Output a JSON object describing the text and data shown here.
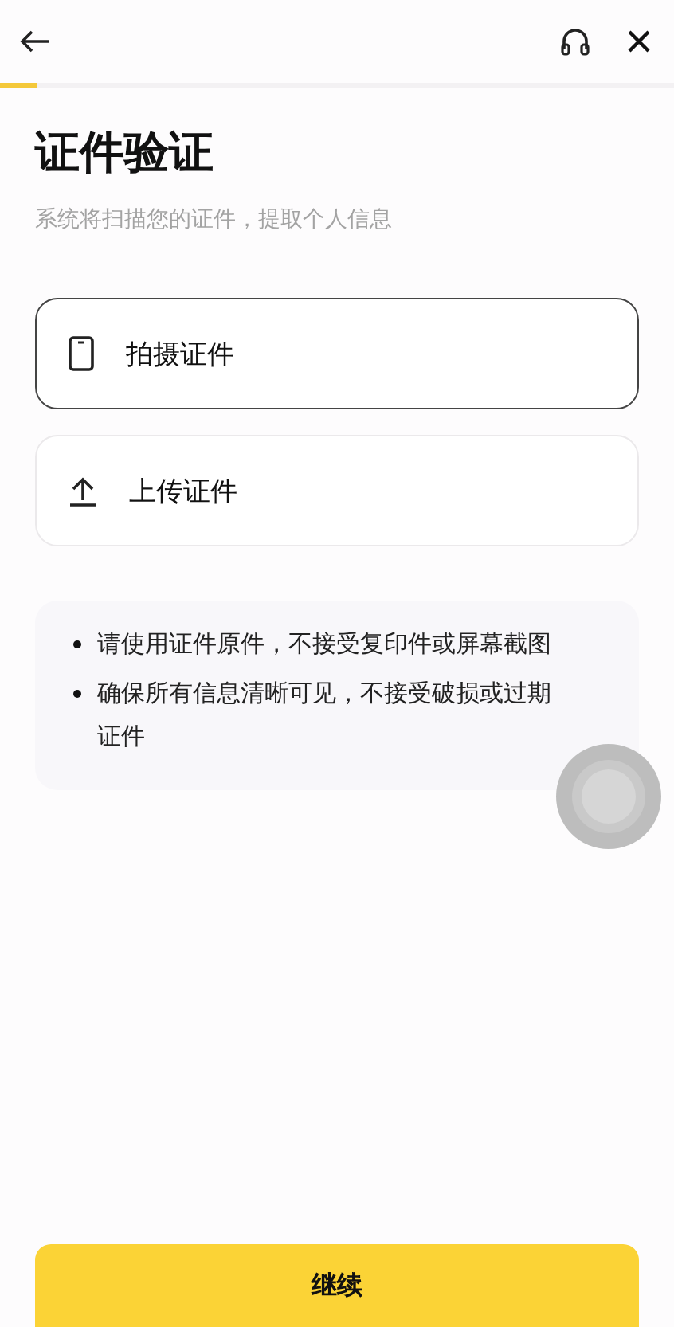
{
  "header": {
    "progress": {
      "level": 0.055
    }
  },
  "title": "证件验证",
  "subtitle": "系统将扫描您的证件，提取个人信息",
  "options": [
    {
      "kind": "camera",
      "label": "拍摄证件",
      "selected": true
    },
    {
      "kind": "upload",
      "label": "上传证件",
      "selected": false
    }
  ],
  "tips": [
    "请使用证件原件，不接受复印件或屏幕截图",
    "确保所有信息清晰可见，不接受破损或过期证件"
  ],
  "continue_button": "继续"
}
